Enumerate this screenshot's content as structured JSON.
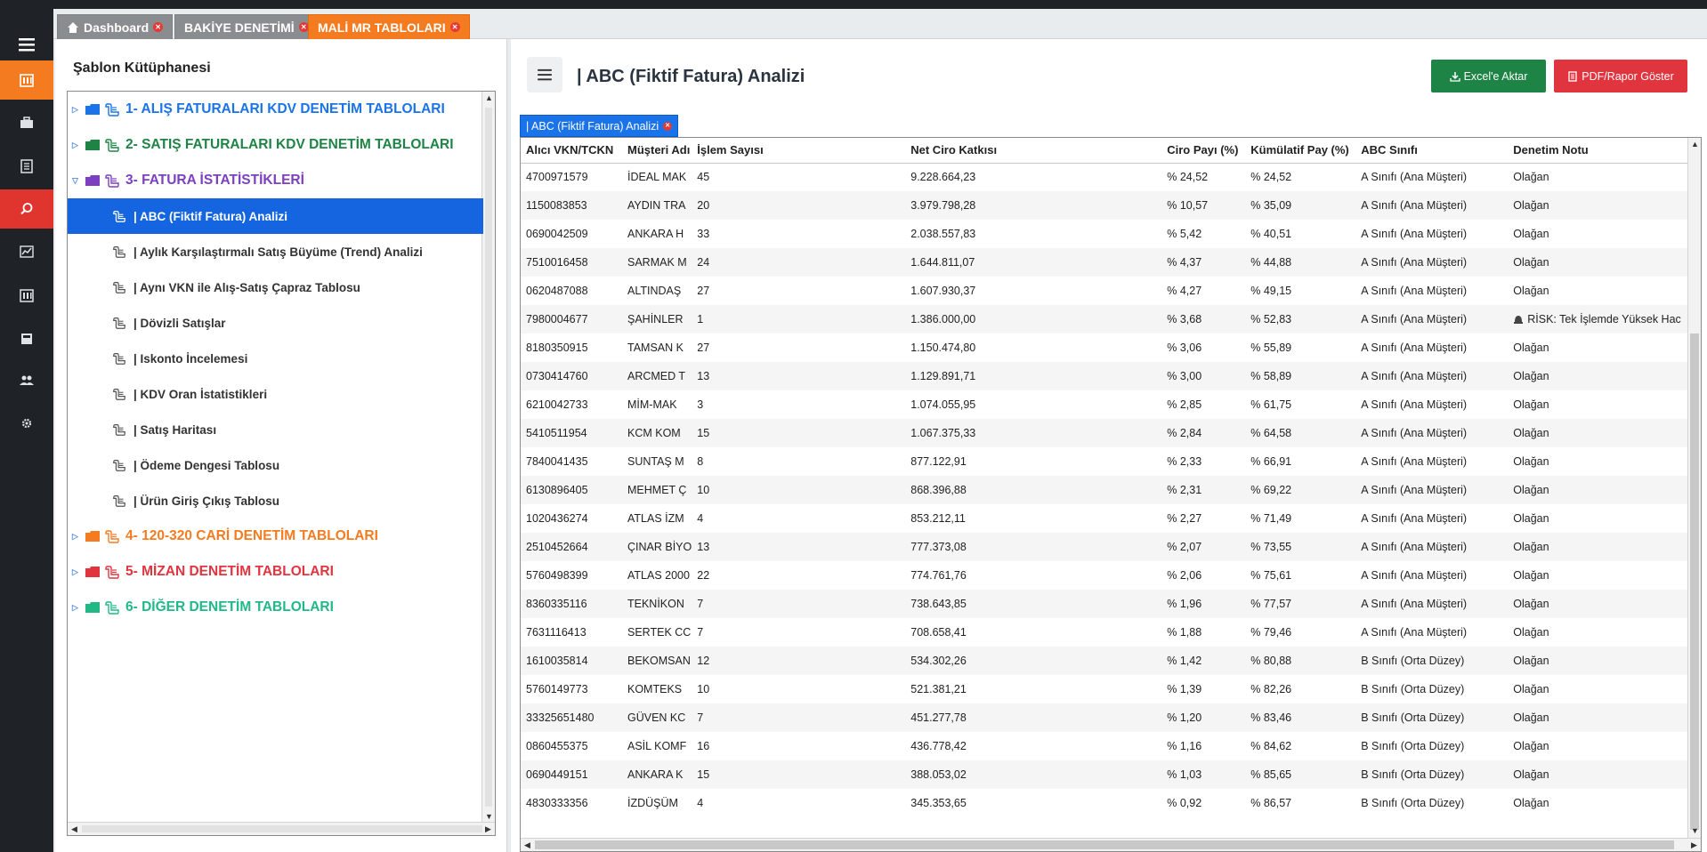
{
  "main_tabs": [
    {
      "label": "Dashboard"
    },
    {
      "label": "BAKİYE DENETİMİ"
    },
    {
      "label": "MALİ MR TABLOLARI"
    }
  ],
  "library": {
    "title": "Şablon Kütüphanesi",
    "categories": [
      {
        "label": "1- ALIŞ FATURALARI KDV DENETİM TABLOLARI",
        "color": "#1a73e8"
      },
      {
        "label": "2- SATIŞ FATURALARI KDV DENETİM TABLOLARI",
        "color": "#1e8446"
      },
      {
        "label": "3- FATURA İSTATİSTİKLERİ",
        "color": "#7b3fbf"
      },
      {
        "label": "4- 120-320 CARİ DENETİM TABLOLARI",
        "color": "#f47b20"
      },
      {
        "label": "5- MİZAN DENETİM TABLOLARI",
        "color": "#e0343f"
      },
      {
        "label": "6- DİĞER DENETİM TABLOLARI",
        "color": "#20b985"
      }
    ],
    "items": [
      {
        "label": "| ABC (Fiktif Fatura) Analizi"
      },
      {
        "label": "| Aylık Karşılaştırmalı Satış Büyüme (Trend) Analizi"
      },
      {
        "label": "| Aynı VKN ile Alış-Satış Çapraz Tablosu"
      },
      {
        "label": "| Dövizli Satışlar"
      },
      {
        "label": "| Iskonto İncelemesi"
      },
      {
        "label": "| KDV Oran İstatistikleri"
      },
      {
        "label": "| Satış Haritası"
      },
      {
        "label": "| Ödeme Dengesi Tablosu"
      },
      {
        "label": "| Ürün Giriş Çıkış Tablosu"
      }
    ]
  },
  "content": {
    "title": "| ABC (Fiktif Fatura) Analizi",
    "excel_label": "Excel'e Aktar",
    "pdf_label": "PDF/Rapor Göster",
    "subtab_label": "| ABC (Fiktif Fatura) Analizi"
  },
  "table": {
    "columns": [
      "Alıcı VKN/TCKN",
      "Müşteri Adı",
      "İşlem Sayısı",
      "Net Ciro Katkısı",
      "Ciro Payı (%)",
      "Kümülatif Pay (%)",
      "ABC Sınıfı",
      "Denetim Notu"
    ],
    "rows": [
      [
        "4700971579",
        "İDEAL MAK",
        "45",
        "9.228.664,23",
        "% 24,52",
        "% 24,52",
        "A Sınıfı (Ana Müşteri)",
        "Olağan"
      ],
      [
        "1150083853",
        "AYDIN TRA",
        "20",
        "3.979.798,28",
        "% 10,57",
        "% 35,09",
        "A Sınıfı (Ana Müşteri)",
        "Olağan"
      ],
      [
        "0690042509",
        "ANKARA H",
        "33",
        "2.038.557,83",
        "% 5,42",
        "% 40,51",
        "A Sınıfı (Ana Müşteri)",
        "Olağan"
      ],
      [
        "7510016458",
        "SARMAK M",
        "24",
        "1.644.811,07",
        "% 4,37",
        "% 44,88",
        "A Sınıfı (Ana Müşteri)",
        "Olağan"
      ],
      [
        "0620487088",
        "ALTINDAŞ",
        "27",
        "1.607.930,37",
        "% 4,27",
        "% 49,15",
        "A Sınıfı (Ana Müşteri)",
        "Olağan"
      ],
      [
        "7980004677",
        "ŞAHİNLER",
        "1",
        "1.386.000,00",
        "% 3,68",
        "% 52,83",
        "A Sınıfı (Ana Müşteri)",
        "RİSK: Tek İşlemde Yüksek Hac"
      ],
      [
        "8180350915",
        "TAMSAN K",
        "27",
        "1.150.474,80",
        "% 3,06",
        "% 55,89",
        "A Sınıfı (Ana Müşteri)",
        "Olağan"
      ],
      [
        "0730414760",
        "ARCMED T",
        "13",
        "1.129.891,71",
        "% 3,00",
        "% 58,89",
        "A Sınıfı (Ana Müşteri)",
        "Olağan"
      ],
      [
        "6210042733",
        "MİM-MAK",
        "3",
        "1.074.055,95",
        "% 2,85",
        "% 61,75",
        "A Sınıfı (Ana Müşteri)",
        "Olağan"
      ],
      [
        "5410511954",
        "KCM KOM",
        "15",
        "1.067.375,33",
        "% 2,84",
        "% 64,58",
        "A Sınıfı (Ana Müşteri)",
        "Olağan"
      ],
      [
        "7840041435",
        "SUNTAŞ M",
        "8",
        "877.122,91",
        "% 2,33",
        "% 66,91",
        "A Sınıfı (Ana Müşteri)",
        "Olağan"
      ],
      [
        "6130896405",
        "MEHMET Ç",
        "10",
        "868.396,88",
        "% 2,31",
        "% 69,22",
        "A Sınıfı (Ana Müşteri)",
        "Olağan"
      ],
      [
        "1020436274",
        "ATLAS İZM",
        "4",
        "853.212,11",
        "% 2,27",
        "% 71,49",
        "A Sınıfı (Ana Müşteri)",
        "Olağan"
      ],
      [
        "2510452664",
        "ÇINAR BİYO",
        "13",
        "777.373,08",
        "% 2,07",
        "% 73,55",
        "A Sınıfı (Ana Müşteri)",
        "Olağan"
      ],
      [
        "5760498399",
        "ATLAS 2000",
        "22",
        "774.761,76",
        "% 2,06",
        "% 75,61",
        "A Sınıfı (Ana Müşteri)",
        "Olağan"
      ],
      [
        "8360335116",
        "TEKNİKON",
        "7",
        "738.643,85",
        "% 1,96",
        "% 77,57",
        "A Sınıfı (Ana Müşteri)",
        "Olağan"
      ],
      [
        "7631116413",
        "SERTEK CC",
        "7",
        "708.658,41",
        "% 1,88",
        "% 79,46",
        "A Sınıfı (Ana Müşteri)",
        "Olağan"
      ],
      [
        "1610035814",
        "BEKOMSAN",
        "12",
        "534.302,26",
        "% 1,42",
        "% 80,88",
        "B Sınıfı (Orta Düzey)",
        "Olağan"
      ],
      [
        "5760149773",
        "KOMTEKS",
        "10",
        "521.381,21",
        "% 1,39",
        "% 82,26",
        "B Sınıfı (Orta Düzey)",
        "Olağan"
      ],
      [
        "33325651480",
        "GÜVEN KC",
        "7",
        "451.277,78",
        "% 1,20",
        "% 83,46",
        "B Sınıfı (Orta Düzey)",
        "Olağan"
      ],
      [
        "0860455375",
        "ASİL KOMF",
        "16",
        "436.778,42",
        "% 1,16",
        "% 84,62",
        "B Sınıfı (Orta Düzey)",
        "Olağan"
      ],
      [
        "0690449151",
        "ANKARA K",
        "15",
        "388.053,02",
        "% 1,03",
        "% 85,65",
        "B Sınıfı (Orta Düzey)",
        "Olağan"
      ],
      [
        "4830333356",
        "İZDÜŞÜM",
        "4",
        "345.353,65",
        "% 0,92",
        "% 86,57",
        "B Sınıfı (Orta Düzey)",
        "Olağan"
      ]
    ]
  }
}
